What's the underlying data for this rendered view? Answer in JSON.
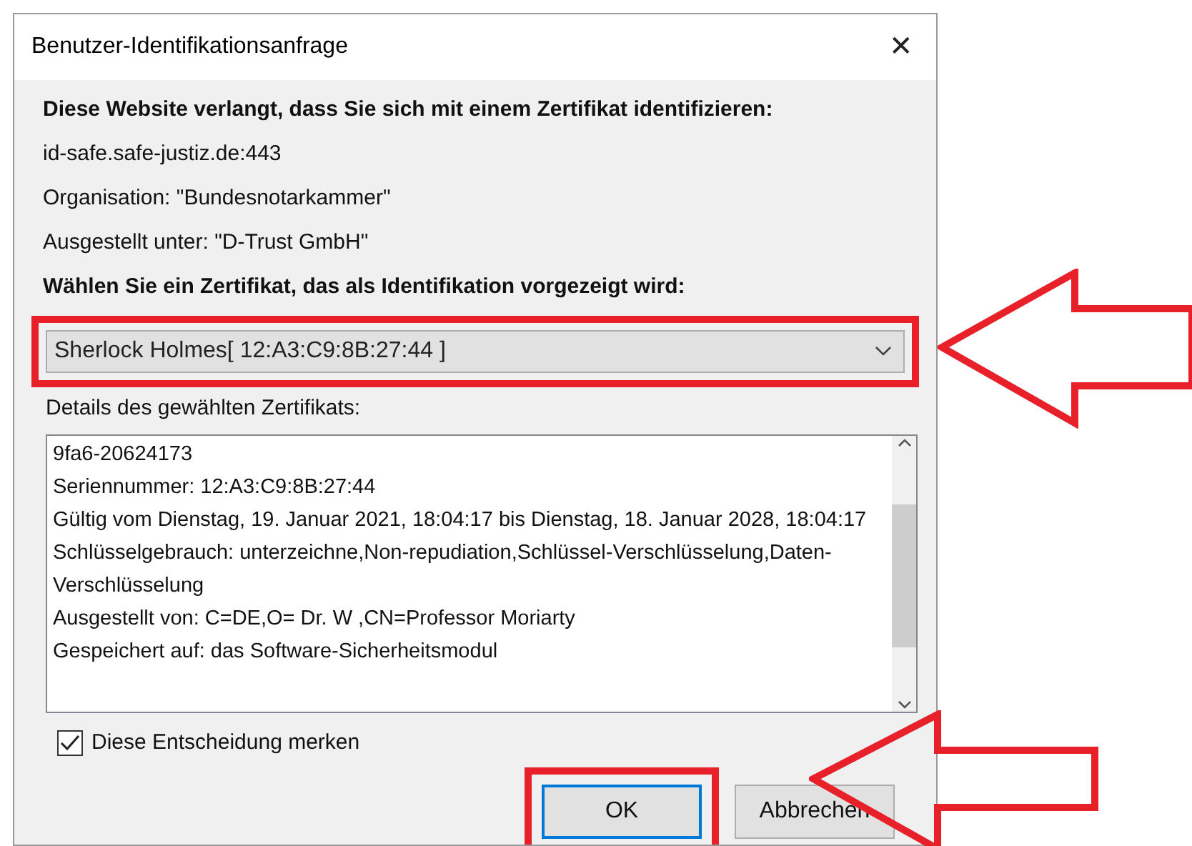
{
  "window": {
    "title": "Benutzer-Identifikationsanfrage",
    "close": "✕"
  },
  "heading": "Diese Website verlangt, dass Sie sich mit einem Zertifikat identifizieren:",
  "info": [
    "id-safe.safe-justiz.de:443",
    "Organisation: \"Bundesnotarkammer\"",
    "Ausgestellt unter: \"D-Trust GmbH\""
  ],
  "choose_label": "Wählen Sie ein Zertifikat, das als Identifikation vorgezeigt wird:",
  "certificate_select": {
    "value": "Sherlock Holmes[ 12:A3:C9:8B:27:44 ]",
    "highlighted": true
  },
  "details_label": "Details des gewählten Zertifikats:",
  "details": [
    "9fa6-20624173",
    "Seriennummer: 12:A3:C9:8B:27:44",
    "Gültig vom Dienstag, 19. Januar 2021, 18:04:17 bis Dienstag, 18. Januar 2028, 18:04:17",
    "Schlüsselgebrauch: unterzeichne,Non-repudiation,Schlüssel-Verschlüsselung,Daten-Verschlüsselung",
    "Ausgestellt von: C=DE,O= Dr. W ,CN=Professor Moriarty",
    "Gespeichert auf: das Software-Sicherheitsmodul"
  ],
  "remember": {
    "label": "Diese Entscheidung merken",
    "checked": true
  },
  "buttons": [
    {
      "label": "OK",
      "default": true,
      "highlighted": true
    },
    {
      "label": "Abbrechen",
      "default": false,
      "highlighted": false
    }
  ],
  "annotations": [
    {
      "kind": "arrow"
    },
    {
      "kind": "arrow"
    }
  ]
}
